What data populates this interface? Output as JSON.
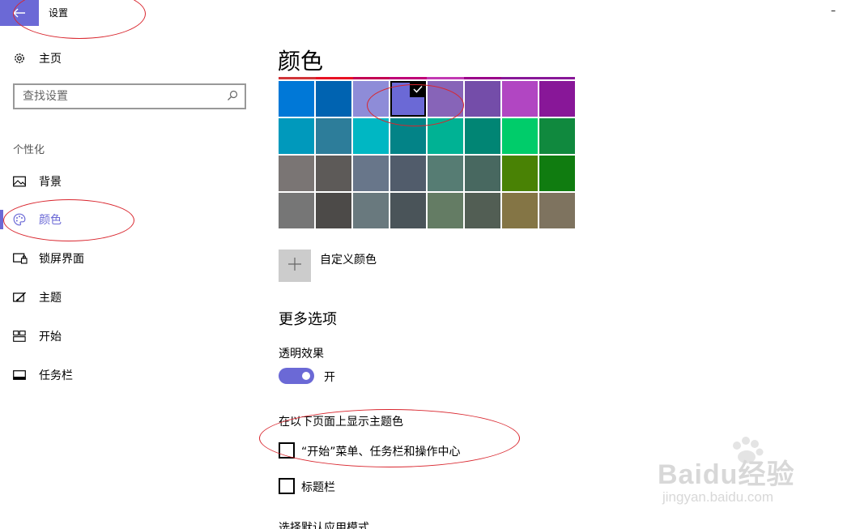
{
  "window": {
    "title": "设置",
    "minimize_glyph": "–"
  },
  "sidebar": {
    "home": {
      "label": "主页",
      "icon": "gear-icon"
    },
    "search_placeholder": "查找设置",
    "section": "个性化",
    "items": [
      {
        "label": "背景",
        "icon": "picture-icon"
      },
      {
        "label": "颜色",
        "icon": "palette-icon",
        "active": true
      },
      {
        "label": "锁屏界面",
        "icon": "lock-screen-icon"
      },
      {
        "label": "主题",
        "icon": "theme-brush-icon"
      },
      {
        "label": "开始",
        "icon": "start-tiles-icon"
      },
      {
        "label": "任务栏",
        "icon": "taskbar-icon"
      }
    ]
  },
  "main": {
    "title": "颜色",
    "top_strip": [
      "#d13438",
      "#e81123",
      "#c30052",
      "#bf0077",
      "#c239b3",
      "#9a0089",
      "#881798",
      "#881798"
    ],
    "palette": [
      [
        "#0078d7",
        "#0063b1",
        "#8e8cd8",
        "#6b69d6",
        "#8764b8",
        "#744da9",
        "#b146c2",
        "#881798"
      ],
      [
        "#0099bc",
        "#2d7d9a",
        "#00b7c3",
        "#038387",
        "#00b294",
        "#018574",
        "#00cc6a",
        "#10893e"
      ],
      [
        "#7a7574",
        "#5d5a58",
        "#68768a",
        "#515c6b",
        "#567c73",
        "#486860",
        "#498205",
        "#107c10"
      ],
      [
        "#767676",
        "#4c4a48",
        "#69797e",
        "#4a5459",
        "#647c64",
        "#525e54",
        "#847545",
        "#7e735f"
      ]
    ],
    "selected": {
      "row": 0,
      "col": 3
    },
    "custom_color": "自定义颜色",
    "more_options": "更多选项",
    "transparency": {
      "label": "透明效果",
      "state": "开",
      "on": true
    },
    "accent_heading": "在以下页面上显示主题色",
    "checkboxes": [
      {
        "label": "“开始”菜单、任务栏和操作中心",
        "checked": false
      },
      {
        "label": "标题栏",
        "checked": false
      }
    ],
    "partial_heading": "选择默认应用模式"
  },
  "watermark": {
    "brand": "Baidu经验",
    "url": "jingyan.baidu.com"
  },
  "colors": {
    "accent": "#6b69d6",
    "annotation": "#d9262e"
  }
}
